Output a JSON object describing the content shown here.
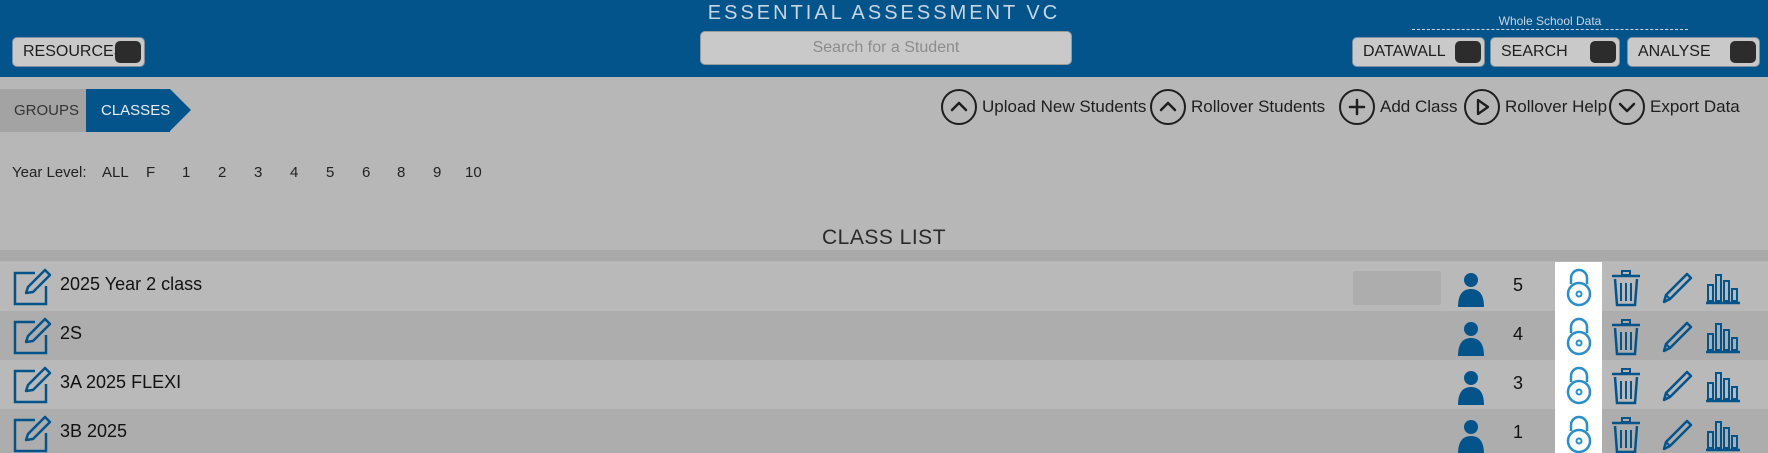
{
  "header": {
    "app_title": "ESSENTIAL ASSESSMENT VC",
    "resources_label": "RESOURCES",
    "search_placeholder": "Search for a Student",
    "whole_school_label": "Whole School Data",
    "datawall_label": "DATAWALL",
    "search_label": "SEARCH",
    "analyse_label": "ANALYSE"
  },
  "breadcrumb": {
    "groups": "GROUPS",
    "classes": "CLASSES"
  },
  "actions": {
    "upload": "Upload New Students",
    "rollover": "Rollover Students",
    "add_class": "Add Class",
    "rollover_help": "Rollover Help",
    "export": "Export Data"
  },
  "year_level": {
    "label": "Year Level:",
    "options": [
      "ALL",
      "F",
      "1",
      "2",
      "3",
      "4",
      "5",
      "6",
      "8",
      "9",
      "10"
    ]
  },
  "class_list": {
    "title": "CLASS LIST",
    "rows": [
      {
        "name": "2025 Year 2 class",
        "count": "5"
      },
      {
        "name": "2S",
        "count": "4"
      },
      {
        "name": "3A 2025 FLEXI",
        "count": "3"
      },
      {
        "name": "3B 2025",
        "count": "1"
      }
    ]
  },
  "colors": {
    "brand_blue": "#04548c",
    "lock_blue": "#2a8fc9"
  }
}
